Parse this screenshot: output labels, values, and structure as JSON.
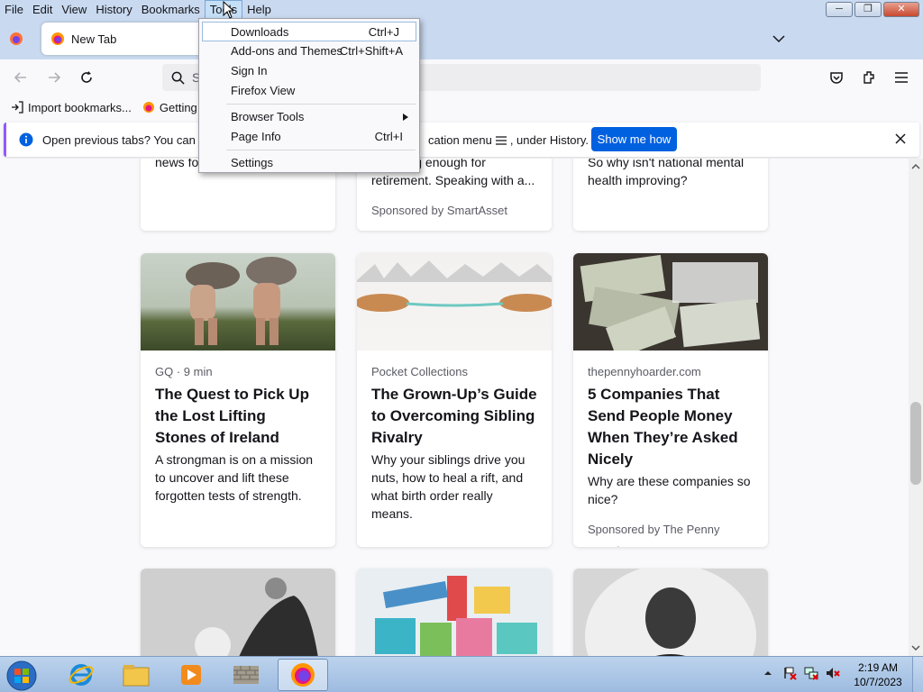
{
  "menubar": {
    "items": [
      "File",
      "Edit",
      "View",
      "History",
      "Bookmarks",
      "Tools",
      "Help"
    ],
    "active_index": 5
  },
  "tabs": [
    {
      "title": "New Tab"
    }
  ],
  "urlbar": {
    "placeholder": "S"
  },
  "bookmarks": [
    {
      "label": "Import bookmarks..."
    },
    {
      "label": "Getting S"
    }
  ],
  "notification": {
    "text_part1": "Open previous tabs? You can rest",
    "text_part2": "cation menu",
    "text_part3": ", under History.",
    "button_label": "Show me how"
  },
  "tools_menu": {
    "items": [
      {
        "label": "Downloads",
        "shortcut": "Ctrl+J",
        "highlighted": true
      },
      {
        "label": "Add-ons and Themes",
        "shortcut": "Ctrl+Shift+A"
      },
      {
        "label": "Sign In",
        "shortcut": ""
      },
      {
        "label": "Firefox View",
        "shortcut": ""
      },
      {
        "label": "Browser Tools",
        "shortcut": "",
        "submenu": true
      },
      {
        "label": "Page Info",
        "shortcut": "Ctrl+I"
      },
      {
        "label": "Settings",
        "shortcut": ""
      }
    ]
  },
  "top_cards": [
    {
      "text_line1": "news fo",
      "text_line2": ""
    },
    {
      "text_line1": "ot saving enough for",
      "text_line2": "retirement. Speaking with a...",
      "sponsor": "Sponsored by SmartAsset"
    },
    {
      "text_line1": "So why isn't national mental",
      "text_line2": "health improving?"
    }
  ],
  "cards": [
    {
      "source": "GQ · 9 min",
      "title": "The Quest to Pick Up the Lost Lifting Stones of Ireland",
      "excerpt": "A strongman is on a mission to uncover and lift these forgotten tests of strength.",
      "sponsor": ""
    },
    {
      "source": "Pocket Collections",
      "title": "The Grown-Up’s Guide to Overcoming Sibling Rivalry",
      "excerpt": "Why your siblings drive you nuts, how to heal a rift, and what birth order really means.",
      "sponsor": ""
    },
    {
      "source": "thepennyhoarder.com",
      "title": "5 Companies That Send People Money When They’re Asked Nicely",
      "excerpt": "Why are these companies so nice?",
      "sponsor": "Sponsored by The Penny Hoarder"
    }
  ],
  "taskbar": {
    "time": "2:19 AM",
    "date": "10/7/2023"
  },
  "colors": {
    "accent": "#0061e0",
    "menubar_bg": "#c9daf0",
    "notif_border": "#9059ff"
  }
}
